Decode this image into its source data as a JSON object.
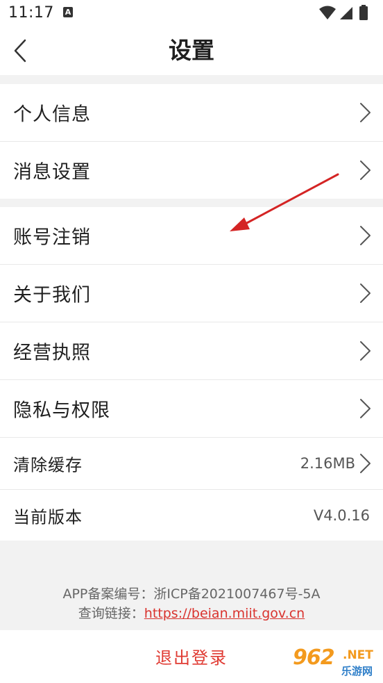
{
  "status_bar": {
    "time": "11:17",
    "notification_glyph": "A",
    "icons": [
      "wifi-icon",
      "signal-icon",
      "battery-icon"
    ]
  },
  "nav": {
    "title": "设置",
    "back_icon": "chevron-left-icon"
  },
  "groups": [
    {
      "items": [
        {
          "label": "个人信息",
          "chevron": true
        },
        {
          "label": "消息设置",
          "chevron": true
        }
      ]
    },
    {
      "items": [
        {
          "label": "账号注销",
          "chevron": true
        },
        {
          "label": "关于我们",
          "chevron": true
        },
        {
          "label": "经营执照",
          "chevron": true
        },
        {
          "label": "隐私与权限",
          "chevron": true
        },
        {
          "label": "清除缓存",
          "value": "2.16MB",
          "chevron": true
        },
        {
          "label": "当前版本",
          "value": "V4.0.16",
          "chevron": false
        }
      ]
    }
  ],
  "footer": {
    "icp_text": "APP备案编号：浙ICP备2021007467号-5A",
    "query_label": "查询链接：",
    "query_url": "https://beian.miit.gov.cn"
  },
  "logout": {
    "label": "退出登录"
  },
  "watermark": {
    "number": "962",
    "suffix": ".NET",
    "cn": "乐游网"
  },
  "colors": {
    "accent_red": "#e03a32",
    "arrow_red": "#d42424",
    "background_gray": "#f2f2f2",
    "divider": "#e8e8e8"
  }
}
